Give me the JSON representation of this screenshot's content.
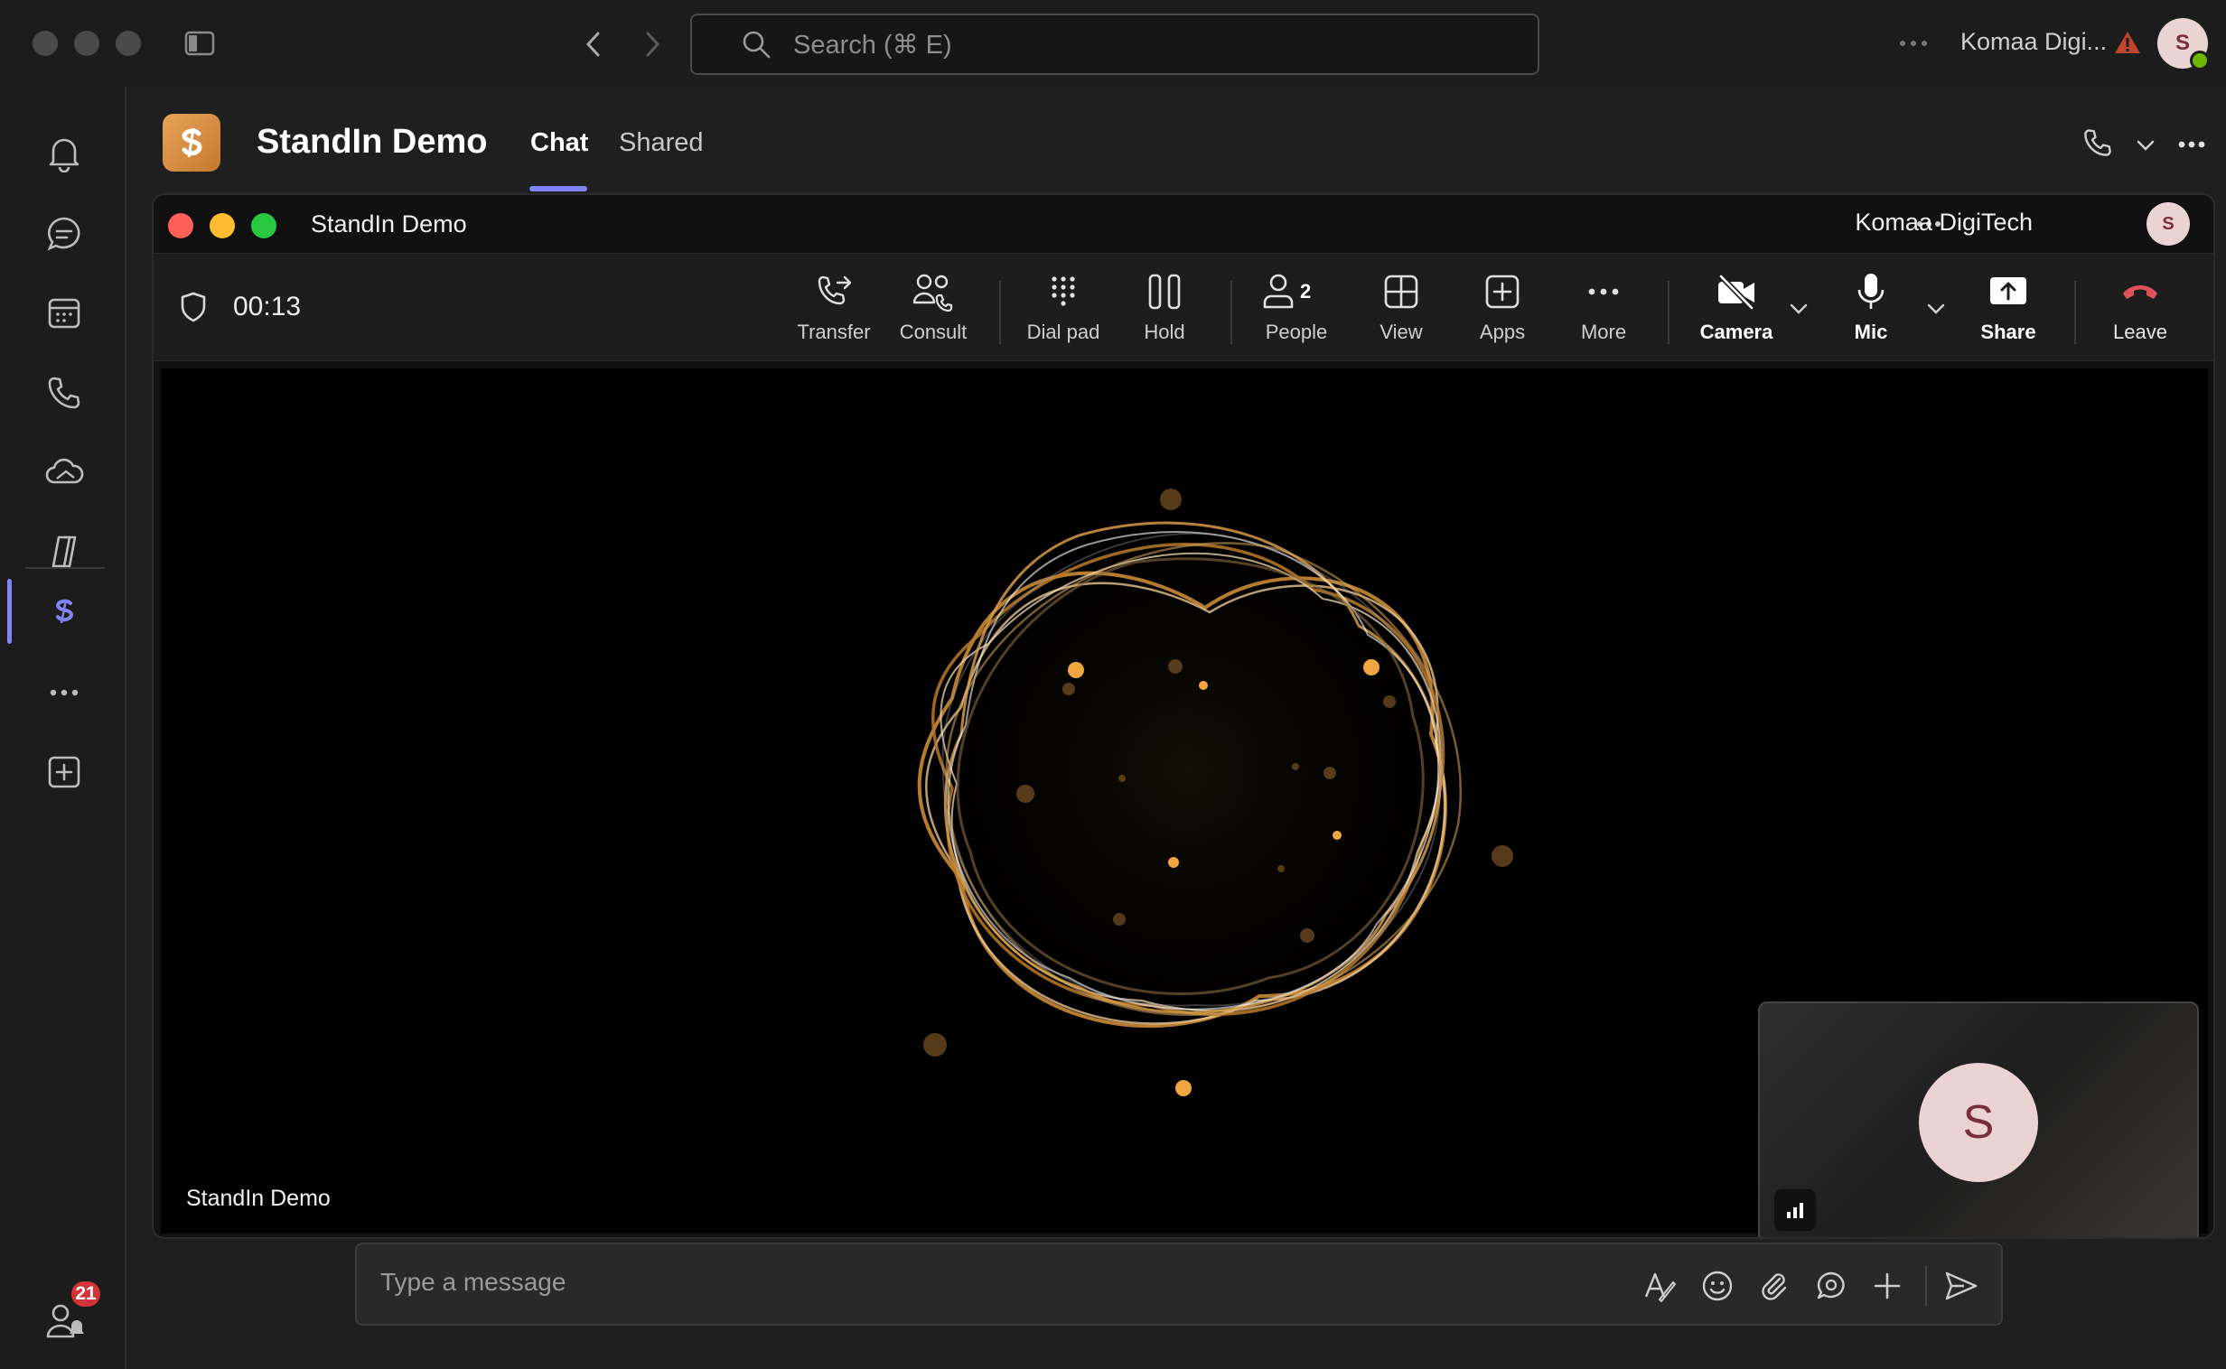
{
  "titlebar": {
    "search_placeholder": "Search (⌘ E)",
    "org_name": "Komaa Digi...",
    "avatar_initial": "S"
  },
  "rail": {
    "items": [
      "activity",
      "chat",
      "calendar",
      "calls",
      "onedrive",
      "copilot",
      "standin-app",
      "more-apps",
      "add-apps"
    ],
    "notification_badge": "21"
  },
  "header": {
    "title": "StandIn Demo",
    "tabs": [
      {
        "label": "Chat",
        "active": true
      },
      {
        "label": "Shared",
        "active": false
      }
    ]
  },
  "meeting": {
    "window_title": "StandIn Demo",
    "org_name": "Komaa DigiTech",
    "avatar_initial": "S",
    "timer": "00:13",
    "toolbar": {
      "transfer": "Transfer",
      "consult": "Consult",
      "dialpad": "Dial pad",
      "hold": "Hold",
      "people": "People",
      "people_count": "2",
      "view": "View",
      "apps": "Apps",
      "more": "More",
      "camera": "Camera",
      "mic": "Mic",
      "share": "Share",
      "leave": "Leave"
    },
    "stage_name": "StandIn Demo",
    "self_initial": "S"
  },
  "compose": {
    "placeholder": "Type a message"
  },
  "colors": {
    "accent": "#7f85f5",
    "leave_red": "#e0525a",
    "brand_orange": "#d88b3c"
  }
}
